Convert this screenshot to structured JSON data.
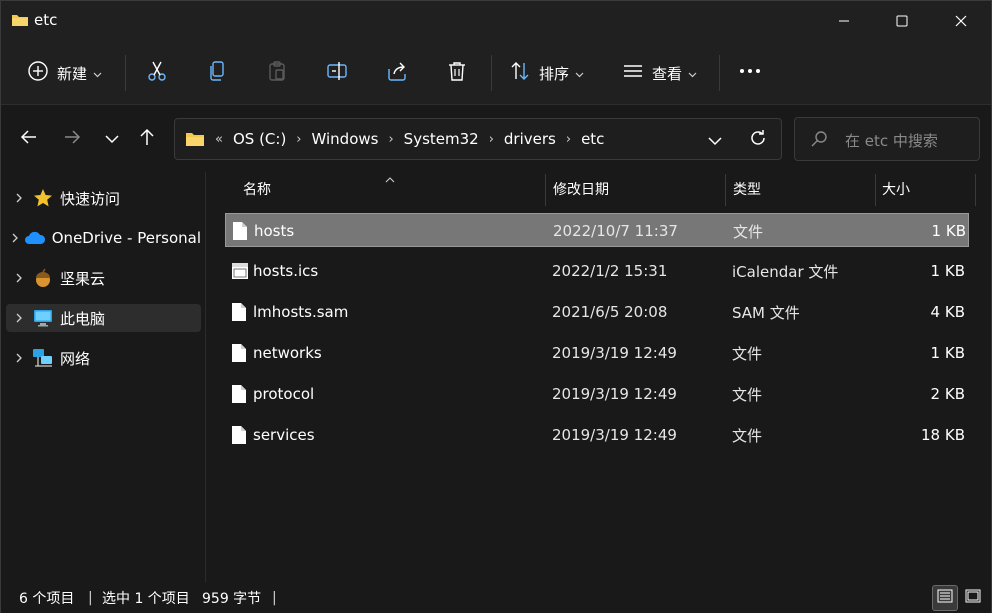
{
  "window": {
    "title": "etc",
    "controls": {
      "minimize": "minimize",
      "maximize": "maximize",
      "close": "close"
    }
  },
  "toolbar": {
    "new_label": "新建",
    "sort_label": "排序",
    "view_label": "查看",
    "icons": [
      "plus-circle-icon",
      "scissors-icon",
      "copy-icon",
      "paste-icon",
      "rename-icon",
      "share-icon",
      "trash-icon",
      "sort-icon",
      "view-icon",
      "more-icon"
    ]
  },
  "address": {
    "overflow": "«",
    "crumbs": [
      "OS (C:)",
      "Windows",
      "System32",
      "drivers",
      "etc"
    ],
    "separator": "›"
  },
  "search": {
    "placeholder": "在 etc 中搜索"
  },
  "sidebar": {
    "items": [
      {
        "label": "快速访问",
        "icon": "star-icon",
        "selected": false
      },
      {
        "label": "OneDrive - Personal",
        "icon": "cloud-icon",
        "selected": false
      },
      {
        "label": "坚果云",
        "icon": "nut-icon",
        "selected": false
      },
      {
        "label": "此电脑",
        "icon": "computer-icon",
        "selected": true
      },
      {
        "label": "网络",
        "icon": "network-icon",
        "selected": false
      }
    ]
  },
  "columns": {
    "name": "名称",
    "modified": "修改日期",
    "type": "类型",
    "size": "大小"
  },
  "files": [
    {
      "name": "hosts",
      "modified": "2022/10/7 11:37",
      "type": "文件",
      "size": "1 KB",
      "selected": true
    },
    {
      "name": "hosts.ics",
      "modified": "2022/1/2 15:31",
      "type": "iCalendar 文件",
      "size": "1 KB",
      "selected": false
    },
    {
      "name": "lmhosts.sam",
      "modified": "2021/6/5 20:08",
      "type": "SAM 文件",
      "size": "4 KB",
      "selected": false
    },
    {
      "name": "networks",
      "modified": "2019/3/19 12:49",
      "type": "文件",
      "size": "1 KB",
      "selected": false
    },
    {
      "name": "protocol",
      "modified": "2019/3/19 12:49",
      "type": "文件",
      "size": "2 KB",
      "selected": false
    },
    {
      "name": "services",
      "modified": "2019/3/19 12:49",
      "type": "文件",
      "size": "18 KB",
      "selected": false
    }
  ],
  "status": {
    "item_count": "6 个项目",
    "selected": "选中 1 个项目",
    "selected_size": "959 字节",
    "divider": "|"
  },
  "colors": {
    "background": "#191919",
    "chrome": "#202020",
    "selected_row": "#777777",
    "folder": "#f2c94c",
    "accent_blue": "#1e90ff"
  }
}
